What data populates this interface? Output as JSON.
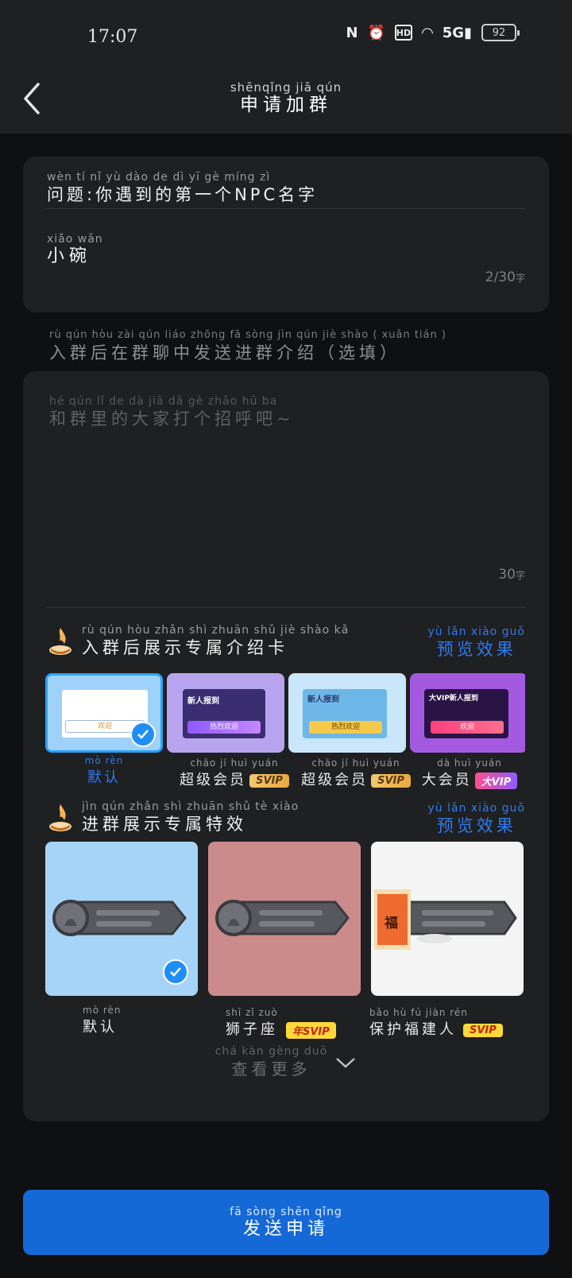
{
  "status": {
    "time": "17:07",
    "battery": "92",
    "net": "5G",
    "hd": "HD"
  },
  "header": {
    "title_pinyin": "shēnqǐng jiā qún",
    "title": "申请加群"
  },
  "question": {
    "pinyin": "wèn tí   nǐ yù dào de dì  yī  gè       míng zì",
    "text": "问题:你遇到的第一个NPC名字",
    "answer_pinyin": "xiǎo wǎn",
    "answer": "小碗",
    "counter": "2/30",
    "counter_unit": "字"
  },
  "intro": {
    "label_pinyin": "rù qún hòu zài qún liáo zhōng fā sòng jìn qún jiè shào ( xuǎn tián )",
    "label": "入群后在群聊中发送进群介绍（选填）",
    "placeholder_pinyin": "hé qún  lǐ   de  dà  jiā  dǎ  gè zhāo hū  ba",
    "placeholder": "和群里的大家打个招呼吧~",
    "counter": "30",
    "counter_unit": "字"
  },
  "card_section": {
    "title_pinyin": "rù qún hòu zhǎn shì zhuān shǔ jiè shào kǎ",
    "title": "入群后展示专属介绍卡",
    "preview_pinyin": "yù lǎn xiào guǒ",
    "preview": "预览效果",
    "items": [
      {
        "pinyin": "mò rèn",
        "label": "默认",
        "badge": "",
        "inner": "欢迎"
      },
      {
        "pinyin": "chāo jí huì yuán",
        "label": "超级会员",
        "badge": "SVIP",
        "inner": "新人报到",
        "btn": "热烈欢迎"
      },
      {
        "pinyin": "chāo jí huì yuán",
        "label": "超级会员",
        "badge": "SVIP",
        "inner": "新人报到",
        "btn": "热烈欢迎"
      },
      {
        "pinyin": "dà huì yuán",
        "label": "大会员",
        "badge": "大VIP",
        "inner": "大VIP新人报到",
        "btn": "欢迎"
      }
    ]
  },
  "fx_section": {
    "title_pinyin": "jìn qún zhǎn shì zhuān shǔ tè xiào",
    "title": "进群展示专属特效",
    "preview_pinyin": "yù lǎn xiào guǒ",
    "preview": "预览效果",
    "items": [
      {
        "pinyin": "mò rèn",
        "label": "默认",
        "badge": ""
      },
      {
        "pinyin": "shī zǐ zuò",
        "label": "狮子座",
        "badge": "年SVIP"
      },
      {
        "pinyin": "bǎo hù fú jiàn rén",
        "label": "保护福建人",
        "badge": "SVIP",
        "fu": "福"
      }
    ]
  },
  "more": {
    "pinyin": "chá kàn gèng duō",
    "label": "查看更多"
  },
  "submit": {
    "pinyin": "fā sòng shēn qǐng",
    "label": "发送申请"
  },
  "colors": {
    "accent": "#1569d6",
    "link": "#2e7bf0",
    "check": "#1f8ef5"
  }
}
